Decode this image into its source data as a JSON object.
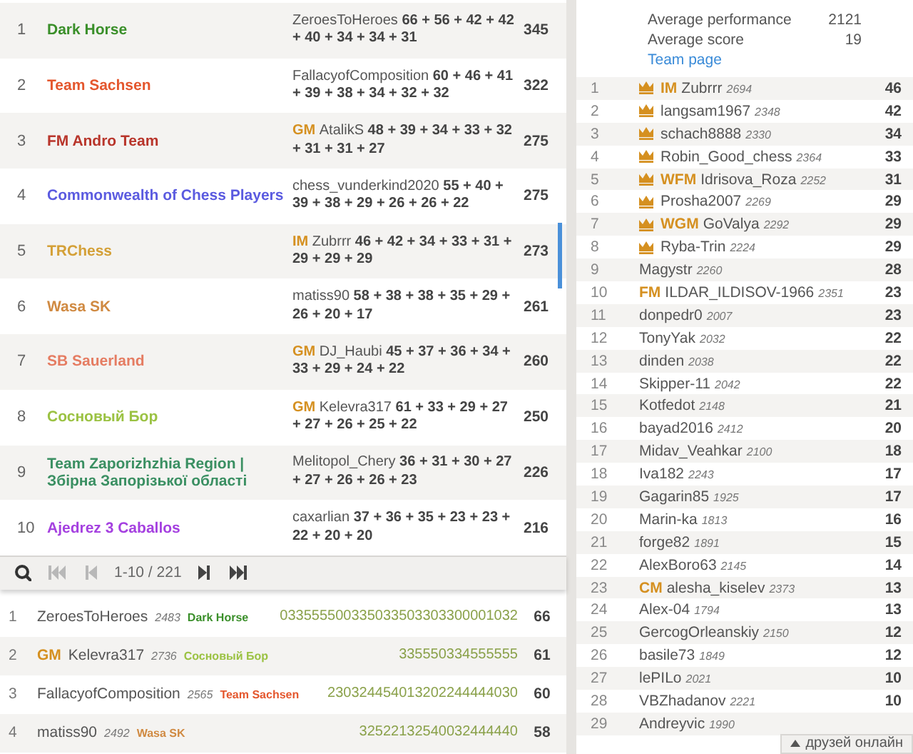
{
  "teams_table": {
    "rows": [
      {
        "rank": "1",
        "team": "Dark Horse",
        "color": "#3a8f2a",
        "leader": "ZeroesToHeroes",
        "scores": "66 + 56 + 42 + 42 + 40 + 34 + 34 + 31",
        "total": "345"
      },
      {
        "rank": "2",
        "team": "Team Sachsen",
        "color": "#e4572e",
        "leader": "FallacyofComposition",
        "scores": "60 + 46 + 41 + 39 + 38 + 34 + 32 + 32",
        "total": "322"
      },
      {
        "rank": "3",
        "team": "FM Andro Team",
        "color": "#b8352b",
        "leader_title": "GM",
        "leader": "AtalikS",
        "scores": "48 + 39 + 34 + 33 + 32 + 31 + 31 + 27",
        "total": "275"
      },
      {
        "rank": "4",
        "team": "Commonwealth of Chess Players",
        "color": "#5b5be0",
        "leader": "chess_vunderkind2020",
        "scores": "55 + 40 + 39 + 38 + 29 + 26 + 26 + 22",
        "total": "275"
      },
      {
        "rank": "5",
        "team": "TRChess",
        "color": "#d4a037",
        "leader_title": "IM",
        "leader": "Zubrrr",
        "scores": "46 + 42 + 34 + 33 + 31 + 29 + 29 + 29",
        "total": "273"
      },
      {
        "rank": "6",
        "team": "Wasa SK",
        "color": "#d08a42",
        "leader": "matiss90",
        "scores": "58 + 38 + 38 + 35 + 29 + 26 + 20 + 17",
        "total": "261"
      },
      {
        "rank": "7",
        "team": "SB Sauerland",
        "color": "#e57c62",
        "leader_title": "GM",
        "leader": "DJ_Haubi",
        "scores": "45 + 37 + 36 + 34 + 33 + 29 + 24 + 22",
        "total": "260"
      },
      {
        "rank": "8",
        "team": "Сосновый Бор",
        "color": "#9bc243",
        "leader_title": "GM",
        "leader": "Kelevra317",
        "scores": "61 + 33 + 29 + 27 + 27 + 26 + 25 + 22",
        "total": "250"
      },
      {
        "rank": "9",
        "team": "Team Zaporizhzhia Region | Збірна Запорізької області",
        "color": "#3a8f62",
        "leader": "Melitopol_Chery",
        "scores": "36 + 31 + 30 + 27 + 27 + 26 + 26 + 23",
        "total": "226"
      },
      {
        "rank": "10",
        "team": "Ajedrez 3 Caballos",
        "color": "#a541e0",
        "leader": "caxarlian",
        "scores": "37 + 36 + 35 + 23 + 23 + 22 + 20 + 20",
        "total": "216"
      }
    ]
  },
  "pager": {
    "buttons": [
      {
        "kind": "search"
      },
      {
        "kind": "first",
        "disabled": true
      },
      {
        "kind": "prev",
        "disabled": true
      },
      {
        "kind": "range",
        "label": "1-10 / 221"
      },
      {
        "kind": "next",
        "disabled": false
      },
      {
        "kind": "last",
        "disabled": false
      }
    ]
  },
  "player_ranking": {
    "rows": [
      {
        "rank": "1",
        "name": "ZeroesToHeroes",
        "rating": "2483",
        "team": "Dark Horse",
        "color": "#3a8f2a",
        "results": "033555500335033503303300001032",
        "points": "66"
      },
      {
        "rank": "2",
        "title": "GM",
        "name": "Kelevra317",
        "rating": "2736",
        "team": "Сосновый Бор",
        "color": "#9bc243",
        "results": "335550334555555",
        "points": "61"
      },
      {
        "rank": "3",
        "name": "FallacyofComposition",
        "rating": "2565",
        "team": "Team Sachsen",
        "color": "#e4572e",
        "results": "230324454013202244444030",
        "points": "60"
      },
      {
        "rank": "4",
        "name": "matiss90",
        "rating": "2492",
        "team": "Wasa SK",
        "color": "#d08a42",
        "results": "32522132540032444440",
        "points": "58"
      }
    ]
  },
  "team_info": {
    "stats": [
      {
        "label": "Average performance",
        "value": "2121"
      },
      {
        "label": "Average score",
        "value": "19"
      }
    ],
    "link": "Team page"
  },
  "members": {
    "rows": [
      {
        "rank": "1",
        "crown": true,
        "title": "IM",
        "name": "Zubrrr",
        "rating": "2694",
        "points": "46"
      },
      {
        "rank": "2",
        "crown": true,
        "name": "langsam1967",
        "rating": "2348",
        "points": "42"
      },
      {
        "rank": "3",
        "crown": true,
        "name": "schach8888",
        "rating": "2330",
        "points": "34"
      },
      {
        "rank": "4",
        "crown": true,
        "name": "Robin_Good_chess",
        "rating": "2364",
        "points": "33"
      },
      {
        "rank": "5",
        "crown": true,
        "title": "WFM",
        "name": "Idrisova_Roza",
        "rating": "2252",
        "points": "31"
      },
      {
        "rank": "6",
        "crown": true,
        "name": "Prosha2007",
        "rating": "2269",
        "points": "29"
      },
      {
        "rank": "7",
        "crown": true,
        "title": "WGM",
        "name": "GoValya",
        "rating": "2292",
        "points": "29"
      },
      {
        "rank": "8",
        "crown": true,
        "name": "Ryba-Trin",
        "rating": "2224",
        "points": "29"
      },
      {
        "rank": "9",
        "crown": false,
        "name": "Magystr",
        "rating": "2260",
        "points": "28"
      },
      {
        "rank": "10",
        "crown": false,
        "title": "FM",
        "name": "ILDAR_ILDISOV-1966",
        "rating": "2351",
        "points": "23"
      },
      {
        "rank": "11",
        "crown": false,
        "name": "donpedr0",
        "rating": "2007",
        "points": "23"
      },
      {
        "rank": "12",
        "crown": false,
        "name": "TonyYak",
        "rating": "2032",
        "points": "22"
      },
      {
        "rank": "13",
        "crown": false,
        "name": "dinden",
        "rating": "2038",
        "points": "22"
      },
      {
        "rank": "14",
        "crown": false,
        "name": "Skipper-11",
        "rating": "2042",
        "points": "22"
      },
      {
        "rank": "15",
        "crown": false,
        "name": "Kotfedot",
        "rating": "2148",
        "points": "21"
      },
      {
        "rank": "16",
        "crown": false,
        "name": "bayad2016",
        "rating": "2412",
        "points": "20"
      },
      {
        "rank": "17",
        "crown": false,
        "name": "Midav_Veahkar",
        "rating": "2100",
        "points": "18"
      },
      {
        "rank": "18",
        "crown": false,
        "name": "Iva182",
        "rating": "2243",
        "points": "17"
      },
      {
        "rank": "19",
        "crown": false,
        "name": "Gagarin85",
        "rating": "1925",
        "points": "17"
      },
      {
        "rank": "20",
        "crown": false,
        "name": "Marin-ka",
        "rating": "1813",
        "points": "16"
      },
      {
        "rank": "21",
        "crown": false,
        "name": "forge82",
        "rating": "1891",
        "points": "15"
      },
      {
        "rank": "22",
        "crown": false,
        "name": "AlexBoro63",
        "rating": "2145",
        "points": "14"
      },
      {
        "rank": "23",
        "crown": false,
        "title": "CM",
        "name": "alesha_kiselev",
        "rating": "2373",
        "points": "13"
      },
      {
        "rank": "24",
        "crown": false,
        "name": "Alex-04",
        "rating": "1794",
        "points": "13"
      },
      {
        "rank": "25",
        "crown": false,
        "name": "GercogOrleanskiy",
        "rating": "2150",
        "points": "12"
      },
      {
        "rank": "26",
        "crown": false,
        "name": "basile73",
        "rating": "1849",
        "points": "12"
      },
      {
        "rank": "27",
        "crown": false,
        "name": "lePILo",
        "rating": "2021",
        "points": "10"
      },
      {
        "rank": "28",
        "crown": false,
        "name": "VBZhadanov",
        "rating": "2221",
        "points": "10"
      },
      {
        "rank": "29",
        "crown": false,
        "name": "Andreyvic",
        "rating": "1990"
      }
    ]
  },
  "friends_button": {
    "label": "друзей онлайн"
  }
}
